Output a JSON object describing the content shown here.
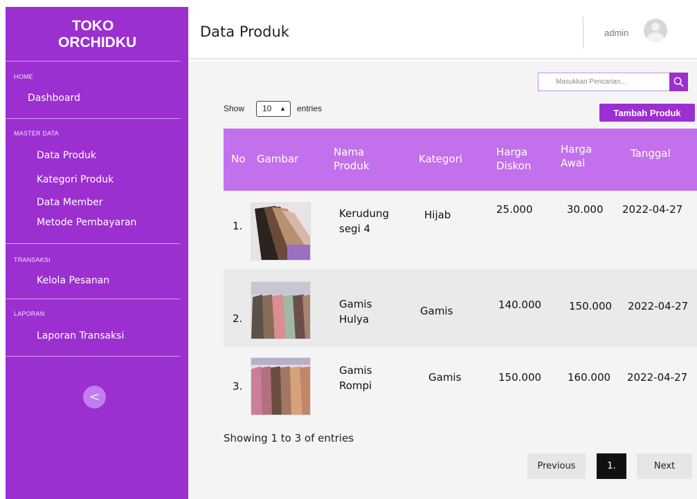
{
  "sidebar": {
    "brand_line1": "TOKO",
    "brand_line2": "ORCHIDKU",
    "sections": {
      "home": {
        "title": "HOME",
        "items": [
          "Dashboard"
        ]
      },
      "master": {
        "title": "MASTER DATA",
        "items": [
          "Data Produk",
          "Kategori Produk",
          "Data Member",
          "Metode Pembayaran"
        ]
      },
      "transaksi": {
        "title": "TRANSAKSI",
        "items": [
          "Kelola Pesanan"
        ]
      },
      "laporan": {
        "title": "LAPORAN",
        "items": [
          "Laporan Transaksi"
        ]
      }
    },
    "collapse_label": "<"
  },
  "header": {
    "title": "Data Produk",
    "user": "admin"
  },
  "search": {
    "placeholder": "Masukkan Pencarian..."
  },
  "entries": {
    "show_label": "Show",
    "value": "10",
    "suffix": "entries"
  },
  "add_button": "Tambah Produk",
  "table": {
    "headers": {
      "no": "No",
      "gambar": "Gambar",
      "nama_1": "Nama",
      "nama_2": "Produk",
      "kategori": "Kategori",
      "diskon_1": "Harga",
      "diskon_2": "Diskon",
      "awal_1": "Harga",
      "awal_2": "Awal",
      "tanggal": "Tanggal"
    },
    "rows": [
      {
        "no": "1.",
        "nama_1": "Kerudung",
        "nama_2": "segi 4",
        "kategori": "Hijab",
        "diskon": "25.000",
        "awal": "30.000",
        "tanggal": "2022-04-27"
      },
      {
        "no": "2.",
        "nama_1": "Gamis",
        "nama_2": "Hulya",
        "kategori": "Gamis",
        "diskon": "140.000",
        "awal": "150.000",
        "tanggal": "2022-04-27"
      },
      {
        "no": "3.",
        "nama_1": "Gamis",
        "nama_2": "Rompi",
        "kategori": "Gamis",
        "diskon": "150.000",
        "awal": "160.000",
        "tanggal": "2022-04-27"
      }
    ]
  },
  "footer": {
    "showing": "Showing 1 to 3 of entries",
    "previous": "Previous",
    "current": "1.",
    "next": "Next"
  },
  "colors": {
    "primary": "#9b2fd0",
    "table_header": "#c270ec",
    "content_bg": "#f4f4f4"
  }
}
